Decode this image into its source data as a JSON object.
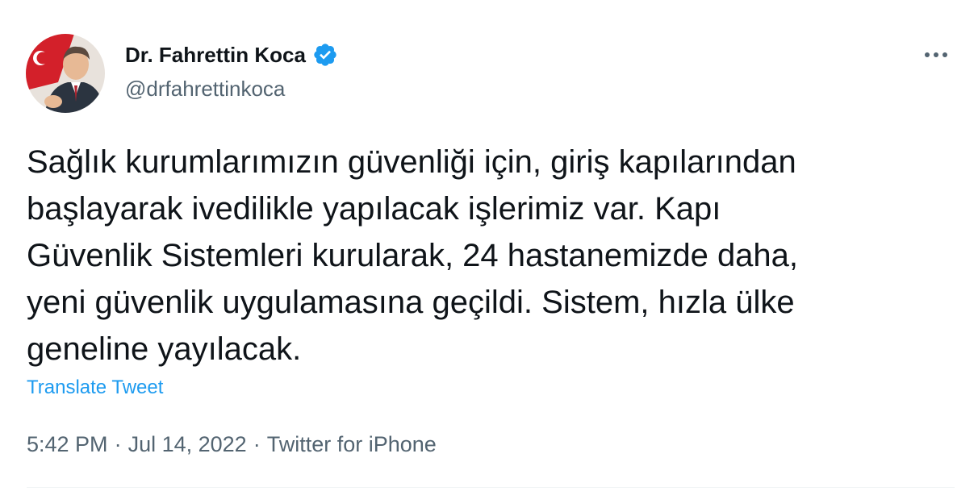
{
  "author": {
    "display_name": "Dr. Fahrettin Koca",
    "handle": "@drfahrettinkoca",
    "verified_icon": "verified-badge-icon",
    "avatar": "avatar-photo"
  },
  "tweet": {
    "text": "Sağlık kurumlarımızın güvenliği için, giriş kapılarından\nbaşlayarak ivedilikle yapılacak işlerimiz var. Kapı\nGüvenlik Sistemleri kurularak, 24 hastanemizde daha,\nyeni güvenlik uygulamasına geçildi. Sistem, hızla ülke\ngeneline yayılacak.",
    "translate_label": "Translate Tweet",
    "time": "5:42 PM",
    "separator": "·",
    "date": "Jul 14, 2022",
    "source": "Twitter for iPhone"
  },
  "more_icon": "more-options-icon",
  "colors": {
    "text": "#0f1419",
    "secondary": "#536471",
    "accent": "#1d9bf0"
  }
}
